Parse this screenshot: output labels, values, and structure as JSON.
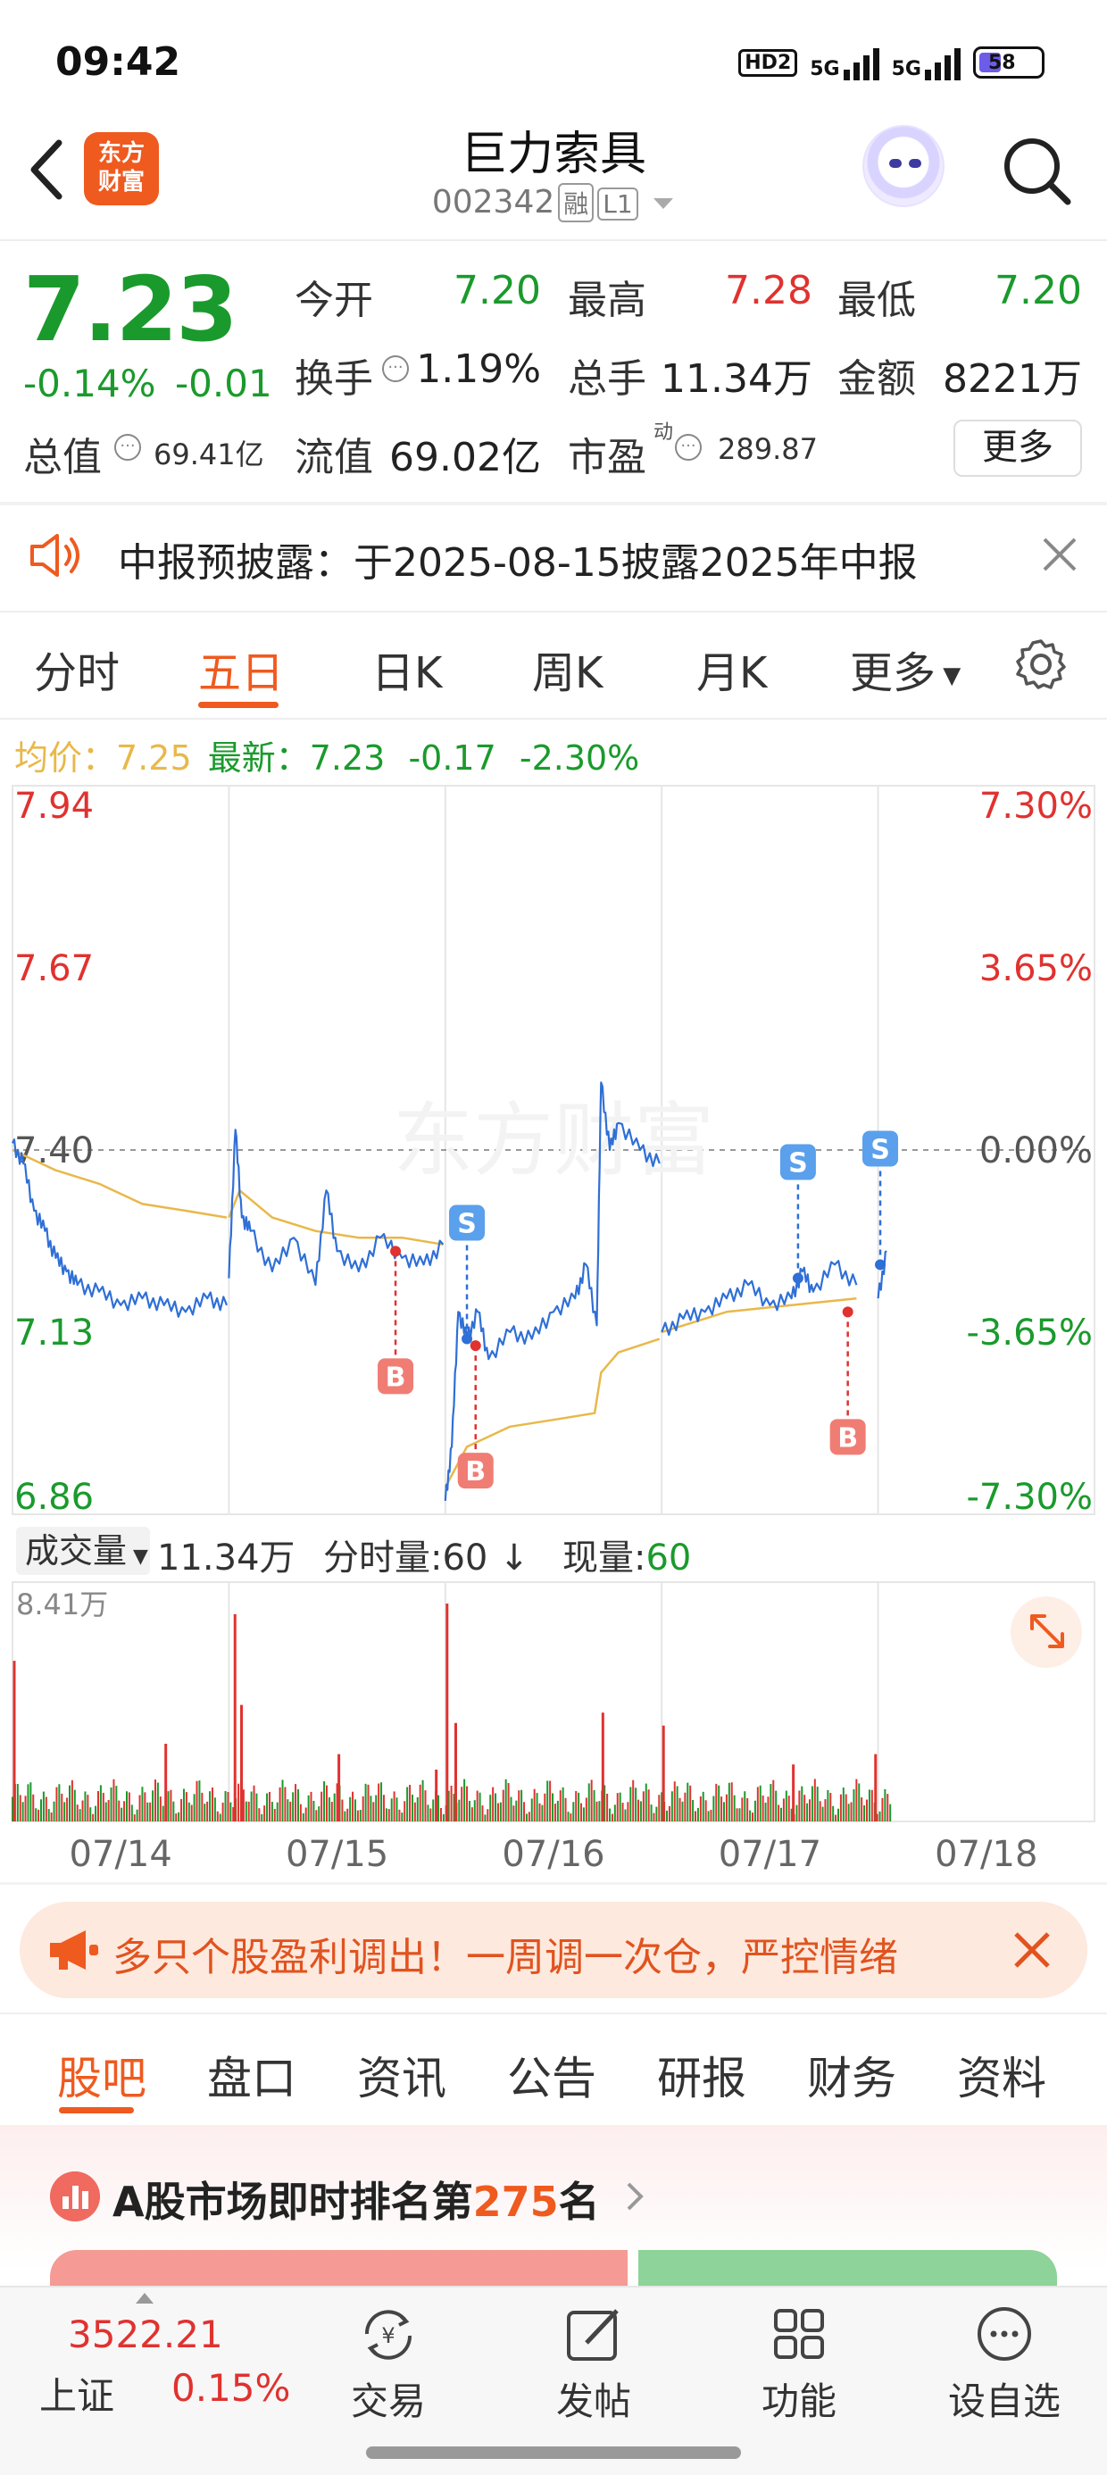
{
  "status_bar": {
    "time": "09:42",
    "hd_label": "HD2",
    "signal1_label": "5G",
    "signal2_label": "5G",
    "battery": "58"
  },
  "header": {
    "logo_text_line1": "东方",
    "logo_text_line2": "财富",
    "stock_name": "巨力索具",
    "stock_code": "002342",
    "tag_margin": "融",
    "tag_level": "L1"
  },
  "quote": {
    "price": "7.23",
    "change_pct": "-0.14%",
    "change_val": "-0.01",
    "open_label": "今开",
    "open_value": "7.20",
    "high_label": "最高",
    "high_value": "7.28",
    "low_label": "最低",
    "low_value": "7.20",
    "turnover_label": "换手",
    "turnover_value": "1.19%",
    "volume_label": "总手",
    "volume_value": "11.34万",
    "amount_label": "金额",
    "amount_value": "8221万",
    "mktcap_label": "总值",
    "mktcap_value": "69.41亿",
    "float_label": "流值",
    "float_value": "69.02亿",
    "pe_label": "市盈",
    "pe_super": "动",
    "pe_value": "289.87",
    "more_label": "更多"
  },
  "notice": {
    "text": "中报预披露：于2025-08-15披露2025年中报"
  },
  "chart_tabs": {
    "items": [
      "分时",
      "五日",
      "日K",
      "周K",
      "月K",
      "更多"
    ],
    "active": "五日"
  },
  "avg_line": {
    "avg_label": "均价：",
    "avg_value": "7.25",
    "latest_label": "最新：",
    "latest_value": "7.23",
    "latest_change": "-0.17",
    "latest_pct": "-2.30%"
  },
  "chart_data": {
    "type": "line",
    "title": "",
    "x_labels": [
      "07/14",
      "07/15",
      "07/16",
      "07/17",
      "07/18"
    ],
    "y_left_ticks": [
      "7.94",
      "7.67",
      "7.40",
      "7.13",
      "6.86"
    ],
    "y_right_ticks": [
      "7.30%",
      "3.65%",
      "0.00%",
      "-3.65%",
      "-7.30%"
    ],
    "ylim": [
      6.86,
      7.94
    ],
    "prev_close": 7.4,
    "watermark": "东方财富",
    "series": [],
    "price_points": [
      [
        0.0,
        7.41
      ],
      [
        0.05,
        7.38
      ],
      [
        0.1,
        7.31
      ],
      [
        0.15,
        7.28
      ],
      [
        0.2,
        7.24
      ],
      [
        0.25,
        7.22
      ],
      [
        0.3,
        7.2
      ],
      [
        0.4,
        7.19
      ],
      [
        0.5,
        7.17
      ],
      [
        0.6,
        7.18
      ],
      [
        0.7,
        7.17
      ],
      [
        0.8,
        7.16
      ],
      [
        0.9,
        7.18
      ],
      [
        0.99,
        7.17
      ],
      [
        1.0,
        7.21
      ],
      [
        1.03,
        7.43
      ],
      [
        1.06,
        7.3
      ],
      [
        1.1,
        7.28
      ],
      [
        1.2,
        7.22
      ],
      [
        1.3,
        7.27
      ],
      [
        1.4,
        7.2
      ],
      [
        1.45,
        7.34
      ],
      [
        1.5,
        7.25
      ],
      [
        1.6,
        7.22
      ],
      [
        1.7,
        7.27
      ],
      [
        1.8,
        7.24
      ],
      [
        1.9,
        7.23
      ],
      [
        1.99,
        7.26
      ],
      [
        2.0,
        6.88
      ],
      [
        2.03,
        6.96
      ],
      [
        2.06,
        7.16
      ],
      [
        2.1,
        7.12
      ],
      [
        2.15,
        7.16
      ],
      [
        2.2,
        7.09
      ],
      [
        2.3,
        7.13
      ],
      [
        2.4,
        7.12
      ],
      [
        2.5,
        7.16
      ],
      [
        2.6,
        7.18
      ],
      [
        2.65,
        7.23
      ],
      [
        2.7,
        7.14
      ],
      [
        2.72,
        7.5
      ],
      [
        2.76,
        7.4
      ],
      [
        2.8,
        7.44
      ],
      [
        2.9,
        7.4
      ],
      [
        2.99,
        7.38
      ],
      [
        3.0,
        7.13
      ],
      [
        3.1,
        7.15
      ],
      [
        3.2,
        7.16
      ],
      [
        3.3,
        7.18
      ],
      [
        3.4,
        7.2
      ],
      [
        3.5,
        7.17
      ],
      [
        3.6,
        7.18
      ],
      [
        3.65,
        7.22
      ],
      [
        3.7,
        7.19
      ],
      [
        3.8,
        7.23
      ],
      [
        3.9,
        7.2
      ],
      [
        4.0,
        7.18
      ],
      [
        4.04,
        7.25
      ]
    ],
    "avg_points": [
      [
        0.0,
        7.4
      ],
      [
        0.2,
        7.37
      ],
      [
        0.4,
        7.35
      ],
      [
        0.6,
        7.32
      ],
      [
        0.8,
        7.31
      ],
      [
        0.99,
        7.3
      ],
      [
        1.0,
        7.3
      ],
      [
        1.05,
        7.34
      ],
      [
        1.2,
        7.3
      ],
      [
        1.4,
        7.28
      ],
      [
        1.6,
        7.27
      ],
      [
        1.8,
        7.27
      ],
      [
        1.99,
        7.26
      ],
      [
        2.0,
        6.9
      ],
      [
        2.1,
        6.96
      ],
      [
        2.3,
        6.99
      ],
      [
        2.5,
        7.0
      ],
      [
        2.69,
        7.01
      ],
      [
        2.72,
        7.07
      ],
      [
        2.8,
        7.1
      ],
      [
        2.99,
        7.12
      ],
      [
        3.0,
        7.13
      ],
      [
        3.3,
        7.16
      ],
      [
        3.6,
        7.17
      ],
      [
        3.9,
        7.18
      ],
      [
        4.04,
        7.18
      ]
    ],
    "markers": [
      {
        "type": "B",
        "x": 1.77,
        "y": 7.25
      },
      {
        "type": "S",
        "x": 2.1,
        "y": 7.12
      },
      {
        "type": "B",
        "x": 2.14,
        "y": 7.11
      },
      {
        "type": "S",
        "x": 3.63,
        "y": 7.21
      },
      {
        "type": "S",
        "x": 4.01,
        "y": 7.23
      },
      {
        "type": "B",
        "x": 3.86,
        "y": 7.16
      }
    ],
    "volume": {
      "max_label": "8.41万",
      "max_value": 8.41,
      "spikes": [
        [
          0.0,
          6.2
        ],
        [
          0.7,
          3.0
        ],
        [
          1.02,
          8.0
        ],
        [
          1.05,
          4.5
        ],
        [
          1.5,
          2.6
        ],
        [
          1.95,
          2.0
        ],
        [
          2.0,
          8.41
        ],
        [
          2.04,
          3.8
        ],
        [
          2.72,
          4.2
        ],
        [
          3.0,
          3.7
        ],
        [
          3.6,
          2.2
        ],
        [
          3.98,
          2.6
        ]
      ]
    }
  },
  "volume_bar": {
    "select_label": "成交量",
    "total": "11.34万",
    "tick_label": "分时量:60",
    "current_label": "现量:",
    "current_value": "60"
  },
  "ad_banner": {
    "text": "多只个股盈利调出！一周调一次仓，严控情绪"
  },
  "sub_tabs": {
    "items": [
      "股吧",
      "盘口",
      "资讯",
      "公告",
      "研报",
      "财务",
      "资料"
    ],
    "active": "股吧"
  },
  "rank_card": {
    "prefix": "A股市场即时排名第",
    "rank": "275",
    "suffix": "名"
  },
  "bottom_nav": {
    "index_value": "3522.21",
    "index_name": "上证",
    "index_change": "0.15%",
    "items": [
      "交易",
      "发帖",
      "功能",
      "设自选"
    ]
  },
  "colors": {
    "accent": "#ef5a1f",
    "up": "#e0322f",
    "down": "#1a9a2c",
    "price_line": "#2f6fd6",
    "avg_line": "#e9b84a"
  }
}
